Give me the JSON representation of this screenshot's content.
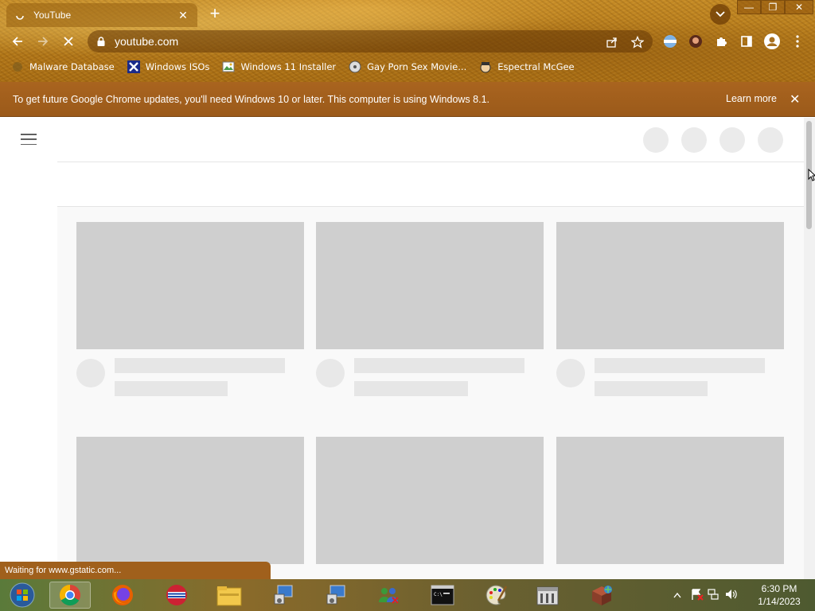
{
  "browser": {
    "tab": {
      "title": "YouTube",
      "favicon": "loading-spinner-icon"
    },
    "address": "youtube.com",
    "theme_color": "#b57a1a"
  },
  "bookmarks": [
    {
      "label": "Malware Database",
      "icon": "bookmark-favicon"
    },
    {
      "label": "Windows ISOs",
      "icon": "x-logo-icon"
    },
    {
      "label": "Windows 11 Installer",
      "icon": "image-icon"
    },
    {
      "label": "Gay Porn Sex Movie...",
      "icon": "cd-icon"
    },
    {
      "label": "Espectral McGee",
      "icon": "face-icon"
    }
  ],
  "infobar": {
    "message": "To get future Google Chrome updates, you'll need Windows 10 or later. This computer is using Windows 8.1.",
    "learn_more": "Learn more"
  },
  "status": {
    "text": "Waiting for www.gstatic.com..."
  },
  "taskbar": {
    "apps": [
      "start-orb",
      "chrome",
      "firefox",
      "opera",
      "file-explorer",
      "network-setup",
      "network-setup-2",
      "people-network",
      "command-prompt",
      "paint",
      "cabinet",
      "minecraft"
    ]
  },
  "clock": {
    "time": "6:30 PM",
    "date": "1/14/2023"
  }
}
